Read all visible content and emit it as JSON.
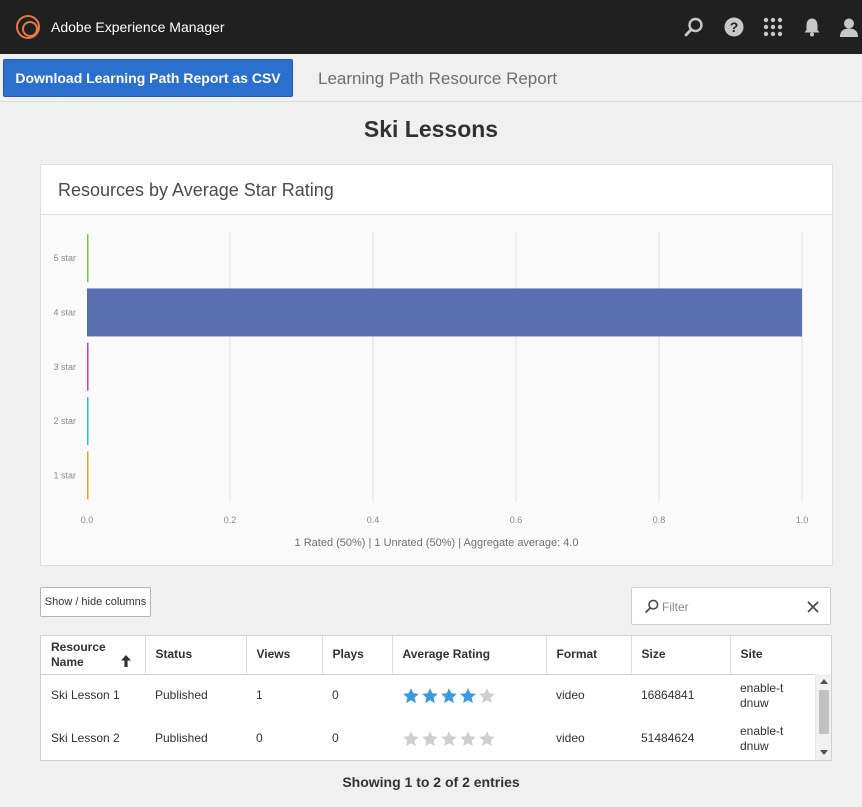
{
  "app": {
    "title": "Adobe Experience Manager"
  },
  "actionbar": {
    "csv_button": "Download Learning Path Report as CSV",
    "report_title": "Learning Path Resource Report"
  },
  "page": {
    "heading": "Ski Lessons"
  },
  "chart_card": {
    "title": "Resources by Average Star Rating",
    "summary": "1 Rated (50%) | 1 Unrated (50%) | Aggregate average: 4.0"
  },
  "chart_data": {
    "type": "bar",
    "orientation": "horizontal",
    "categories": [
      "5 star",
      "4 star",
      "3 star",
      "2 star",
      "1 star"
    ],
    "values": [
      0.0,
      1.0,
      0.0,
      0.0,
      0.0
    ],
    "colors": [
      "#7cc242",
      "#5a6fb0",
      "#c63fb0",
      "#27c2c8",
      "#e8a21a"
    ],
    "xticks": [
      "0.0",
      "0.2",
      "0.4",
      "0.6",
      "0.8",
      "1.0"
    ],
    "xlim": [
      0,
      1
    ],
    "grid": true,
    "title": "",
    "xlabel": "",
    "ylabel": ""
  },
  "controls": {
    "columns_button": "Show / hide columns",
    "filter_placeholder": "Filter"
  },
  "table": {
    "columns": [
      "Resource Name",
      "Status",
      "Views",
      "Plays",
      "Average Rating",
      "Format",
      "Size",
      "Site"
    ],
    "rows": [
      {
        "name": "Ski Lesson 1",
        "status": "Published",
        "views": "1",
        "plays": "0",
        "rating": 4,
        "format": "video",
        "size": "16864841",
        "site": "enable-tdnuw"
      },
      {
        "name": "Ski Lesson 2",
        "status": "Published",
        "views": "0",
        "plays": "0",
        "rating": 0,
        "format": "video",
        "size": "51484624",
        "site": "enable-tdnuw"
      }
    ]
  },
  "footer": {
    "entries": "Showing 1 to 2 of 2 entries"
  },
  "colors": {
    "accent": "#2b6fcf",
    "topbar": "#202020",
    "star_filled": "#3b9be2",
    "star_empty": "#cfcfcf"
  }
}
